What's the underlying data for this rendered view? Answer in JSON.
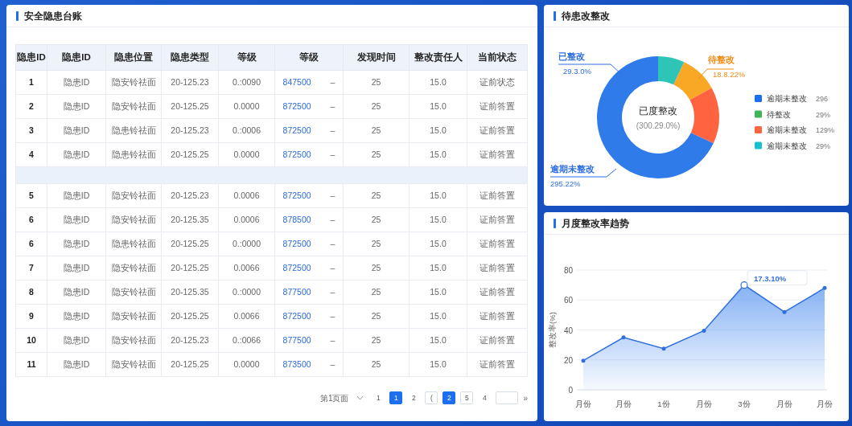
{
  "ledger": {
    "title": "安全隐患台账",
    "columns": [
      "隐患ID",
      "隐患ID",
      "隐患位置",
      "隐患类型",
      "等级",
      "等级",
      "发现时间",
      "整改责任人",
      "当前状态"
    ],
    "rows": [
      {
        "kind": "data",
        "cells": [
          "1",
          "隐患ID",
          "隐安铃祛面",
          "20-125.23",
          "0.:0090",
          "847500",
          "–",
          "25",
          "15.0",
          "证前状态"
        ]
      },
      {
        "kind": "data",
        "cells": [
          "2",
          "隐患ID",
          "隐安铃祛面",
          "20-125.25",
          "0.0000",
          "872500",
          "–",
          "25",
          "15.0",
          "证前答置"
        ]
      },
      {
        "kind": "data",
        "cells": [
          "3",
          "隐患ID",
          "隐患铃祛面",
          "20-125.23",
          "0.:0006",
          "872500",
          "–",
          "25",
          "15.0",
          "证前答置"
        ]
      },
      {
        "kind": "data",
        "cells": [
          "4",
          "隐患ID",
          "隐患铃祛面",
          "20-125.25",
          "0.0000",
          "872500",
          "–",
          "25",
          "15.0",
          "证前答置"
        ]
      },
      {
        "kind": "blank"
      },
      {
        "kind": "data",
        "cells": [
          "5",
          "隐患ID",
          "隐安铃祛面",
          "20-125.23",
          "0.0006",
          "872500",
          "–",
          "25",
          "15.0",
          "证前答置"
        ]
      },
      {
        "kind": "data",
        "cells": [
          "6",
          "隐患ID",
          "隐安铃祛面",
          "20-125.35",
          "0.0006",
          "878500",
          "–",
          "25",
          "15.0",
          "证前答置"
        ]
      },
      {
        "kind": "data",
        "cells": [
          "6",
          "隐患ID",
          "隐患铃祛面",
          "20-125.25",
          "0.:0000",
          "872500",
          "–",
          "25",
          "15.0",
          "证前答置"
        ]
      },
      {
        "kind": "data",
        "cells": [
          "7",
          "隐患ID",
          "隐安铃祛面",
          "20-125.25",
          "0.0066",
          "872500",
          "–",
          "25",
          "15.0",
          "证前答置"
        ]
      },
      {
        "kind": "data",
        "cells": [
          "8",
          "隐患ID",
          "隐安铃祛面",
          "20-125.35",
          "0.:0000",
          "877500",
          "–",
          "25",
          "15.0",
          "证前答置"
        ]
      },
      {
        "kind": "data",
        "cells": [
          "9",
          "隐患ID",
          "隐安铃祛面",
          "20-125.25",
          "0.0066",
          "872500",
          "–",
          "25",
          "15.0",
          "证前答置"
        ]
      },
      {
        "kind": "data",
        "cells": [
          "10",
          "隐患ID",
          "隐安铃祛面",
          "20-125.23",
          "0.:0066",
          "877500",
          "–",
          "25",
          "15.0",
          "证前答置"
        ]
      },
      {
        "kind": "data",
        "cells": [
          "11",
          "隐患ID",
          "隐安铃祛面",
          "20-125.25",
          "0.0000",
          "873500",
          "–",
          "25",
          "15.0",
          "证前答置"
        ]
      }
    ],
    "pagination": {
      "label": "第1页面",
      "pages": [
        {
          "text": "1",
          "kind": "plain",
          "selected": false
        },
        {
          "text": "1",
          "kind": "boxed",
          "selected": true
        },
        {
          "text": "2",
          "kind": "plain",
          "selected": false
        },
        {
          "text": "(",
          "kind": "boxed",
          "selected": false
        },
        {
          "text": "2",
          "kind": "boxed",
          "selected": true
        },
        {
          "text": "5",
          "kind": "boxed",
          "selected": false
        },
        {
          "text": "4",
          "kind": "plain",
          "selected": false
        }
      ],
      "next": "»"
    }
  },
  "pending": {
    "title": "待患改整改",
    "center_title": "已度整改",
    "center_value": "(300.29.0%)",
    "callouts": [
      {
        "label": "已整改",
        "value": "29.3.0%",
        "color": "#2f6fe0"
      },
      {
        "label": "待整改",
        "value": "18.8.22%",
        "color": "#f08c18"
      },
      {
        "label": "逾期未整改",
        "value": "295.22%",
        "color": "#2f6fe0"
      }
    ],
    "legend": [
      {
        "label": "逾期未整改",
        "value": "296",
        "color": "#1e6ff0"
      },
      {
        "label": "待整改",
        "value": "29%",
        "color": "#3fb55a"
      },
      {
        "label": "逾期未整改",
        "value": "129%",
        "color": "#ff6340"
      },
      {
        "label": "逾期未整改",
        "value": "29%",
        "color": "#17c1d0"
      }
    ]
  },
  "trend": {
    "title": "月度整改率趋势",
    "chart_data": {
      "type": "area",
      "ylabel": "整改率(%)",
      "categories": [
        "月份",
        "月份",
        "1份",
        "月份",
        "3份",
        "月份",
        "月份"
      ],
      "series": [
        {
          "color": "#2f6fe0",
          "values": [
            19.5,
            35,
            27.5,
            39.5,
            70,
            52,
            68
          ]
        }
      ],
      "ylim": [
        0,
        80
      ],
      "yticks": [
        0,
        20,
        40,
        60,
        80
      ],
      "grid": true,
      "annotations": [
        {
          "x": "3份",
          "y": 70,
          "text": "17.3.10%"
        }
      ]
    }
  }
}
